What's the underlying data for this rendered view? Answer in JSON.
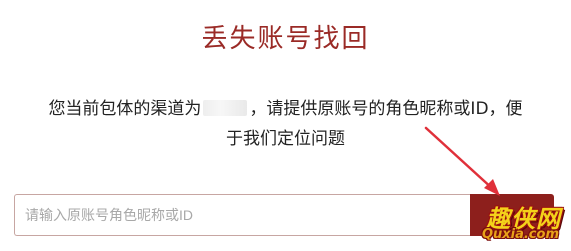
{
  "dialog": {
    "title": "丢失账号找回",
    "desc_part1": "您当前包体的渠道为",
    "desc_part2": "，请提供原账号的角色昵称或ID，便",
    "desc_line2": "于我们定位问题"
  },
  "input": {
    "placeholder": "请输入原账号角色昵称或ID"
  },
  "watermark": {
    "cn": "趣侠网",
    "en": "Quxia.com"
  },
  "colors": {
    "title": "#9a2a26",
    "button": "#8d1f1c",
    "arrow": "#e0303a"
  }
}
